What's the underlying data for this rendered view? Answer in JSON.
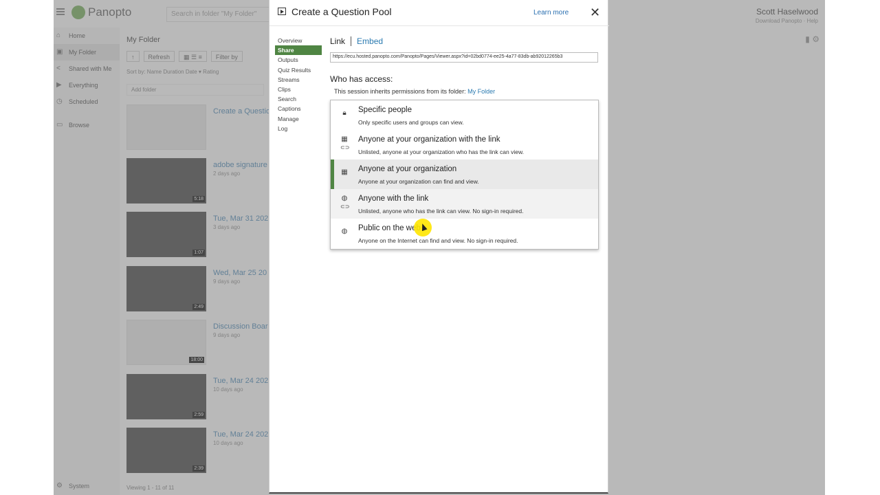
{
  "app": {
    "brand": "Panopto",
    "search_placeholder": "Search in folder \"My Folder\"",
    "user_name": "Scott Haselwood",
    "user_sub": "Download Panopto · Help"
  },
  "sidebar": {
    "items": [
      {
        "label": "Home",
        "icon": "home-icon"
      },
      {
        "label": "My Folder",
        "icon": "folder-icon"
      },
      {
        "label": "Shared with Me",
        "icon": "share-icon"
      },
      {
        "label": "Everything",
        "icon": "video-icon"
      },
      {
        "label": "Scheduled",
        "icon": "clock-icon"
      },
      {
        "label": "Browse",
        "icon": "browse-icon"
      }
    ],
    "system": "System"
  },
  "folder": {
    "title": "My Folder",
    "refresh": "Refresh",
    "filter": "Filter by",
    "sort": "Sort by:   Name   Duration   Date ▾   Rating",
    "add_folder": "Add folder",
    "viewing": "Viewing 1 - 11 of 11"
  },
  "videos": [
    {
      "title": "Create a Questio",
      "sub": "",
      "duration": "",
      "light": true
    },
    {
      "title": "adobe signature",
      "sub": "2 days ago",
      "duration": "5:18",
      "light": false
    },
    {
      "title": "Tue, Mar 31 202",
      "sub": "3 days ago",
      "duration": "1:07",
      "light": false
    },
    {
      "title": "Wed, Mar 25 20",
      "sub": "9 days ago",
      "duration": "2:49",
      "light": false
    },
    {
      "title": "Discussion Boar",
      "sub": "9 days ago",
      "duration": "18:00",
      "light": true
    },
    {
      "title": "Tue, Mar 24 202",
      "sub": "10 days ago",
      "duration": "2:59",
      "light": false
    },
    {
      "title": "Tue, Mar 24 202",
      "sub": "10 days ago",
      "duration": "2:39",
      "light": false
    }
  ],
  "modal": {
    "title": "Create a Question Pool",
    "learn_more": "Learn more",
    "close": "✕",
    "nav": [
      "Overview",
      "Share",
      "Outputs",
      "Quiz Results",
      "Streams",
      "Clips",
      "Search",
      "Captions",
      "Manage",
      "Log"
    ],
    "active_nav": "Share",
    "tab_link": "Link",
    "tab_embed": "Embed",
    "url": "https://ecu.hosted.panopto.com/Panopto/Pages/Viewer.aspx?id=02bd0774-ee25-4a77-83db-ab92012265b3",
    "access_heading": "Who has access:",
    "inherit_text": "This session inherits permissions from its folder:",
    "inherit_folder": "My Folder",
    "options": [
      {
        "title": "Specific people",
        "desc": "Only specific users and groups can view.",
        "icon": "lock-icon",
        "state": "normal"
      },
      {
        "title": "Anyone at your organization with the link",
        "desc": "Unlisted, anyone at your organization who has the link can view.",
        "icon": "org-link-icon",
        "state": "normal"
      },
      {
        "title": "Anyone at your organization",
        "desc": "Anyone at your organization can find and view.",
        "icon": "org-icon",
        "state": "selected"
      },
      {
        "title": "Anyone with the link",
        "desc": "Unlisted, anyone who has the link can view. No sign-in required.",
        "icon": "globe-link-icon",
        "state": "hover"
      },
      {
        "title": "Public on the web",
        "desc": "Anyone on the Internet can find and view. No sign-in required.",
        "icon": "globe-icon",
        "state": "normal"
      }
    ]
  },
  "colors": {
    "accent": "#4f8543",
    "link": "#2a7ab0"
  }
}
